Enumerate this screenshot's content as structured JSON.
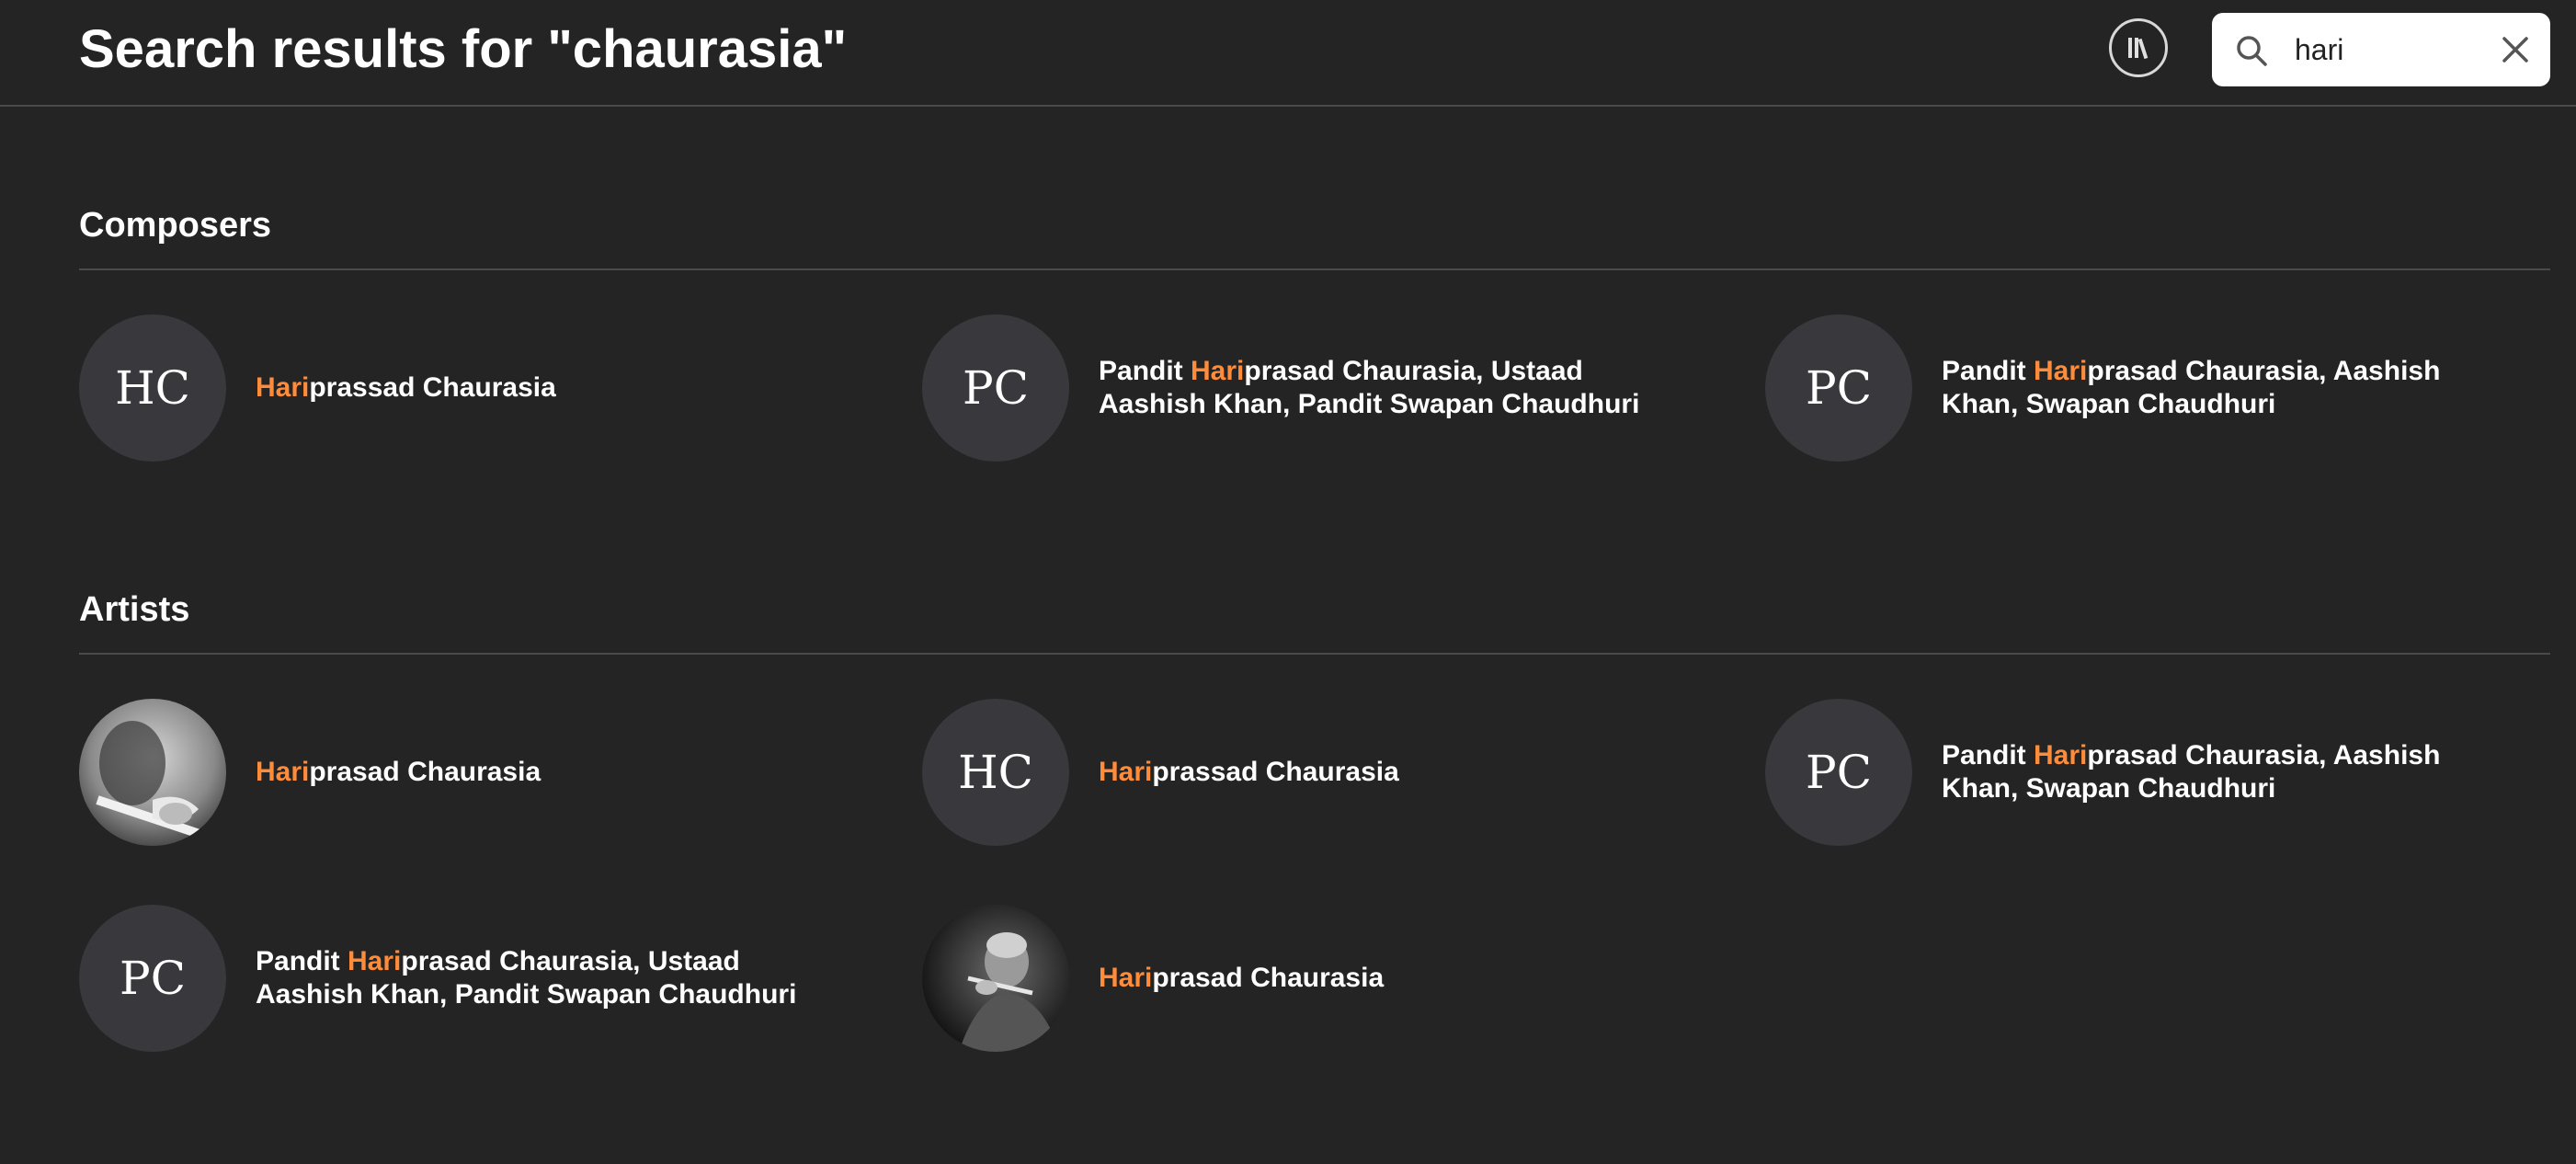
{
  "header": {
    "title": "Search results for \"chaurasia\"",
    "library_icon": "library-icon"
  },
  "search": {
    "value": "hari",
    "search_icon": "search-icon",
    "clear_icon": "close-icon"
  },
  "colors": {
    "background": "#242424",
    "highlight": "#ff8c3a",
    "avatar_bg": "#38383d",
    "divider": "#4a4a4a"
  },
  "composers": {
    "title": "Composers",
    "items": [
      {
        "initials": "HC",
        "highlight": "Hari",
        "rest": "prassad Chaurasia",
        "prefix": ""
      },
      {
        "initials": "PC",
        "prefix": "Pandit ",
        "highlight": "Hari",
        "rest": "prasad Chaurasia, Ustaad Aashish Khan, Pandit Swapan Chaudhuri"
      },
      {
        "initials": "PC",
        "prefix": "Pandit ",
        "highlight": "Hari",
        "rest": "prasad Chaurasia, Aashish Khan, Swapan Chaudhuri"
      }
    ]
  },
  "artists": {
    "title": "Artists",
    "items": [
      {
        "initials": "",
        "photo": "photo-avatar",
        "prefix": "",
        "highlight": "Hari",
        "rest": "prasad Chaurasia"
      },
      {
        "initials": "HC",
        "prefix": "",
        "highlight": "Hari",
        "rest": "prassad Chaurasia"
      },
      {
        "initials": "PC",
        "prefix": "Pandit ",
        "highlight": "Hari",
        "rest": "prasad Chaurasia, Aashish Khan, Swapan Chaudhuri"
      },
      {
        "initials": "PC",
        "prefix": "Pandit ",
        "highlight": "Hari",
        "rest": "prasad Chaurasia, Ustaad Aashish Khan, Pandit Swapan Chaudhuri"
      },
      {
        "initials": "",
        "photo": "photo-avatar",
        "prefix": "",
        "highlight": "Hari",
        "rest": "prasad Chaurasia"
      }
    ]
  }
}
